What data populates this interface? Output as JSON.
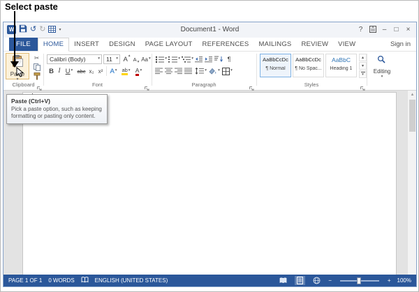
{
  "annotation": {
    "label": "Select paste"
  },
  "glyphs": {
    "dropdown": "▾",
    "up": "▴",
    "undo": "↺",
    "redo": "↻",
    "cut": "✂",
    "scroll_up": "▲"
  },
  "window": {
    "titlebar": {
      "app_initial": "W",
      "title": "Document1 - Word",
      "help": "?",
      "minimize": "–",
      "maximize": "□",
      "close": "×"
    },
    "tabs": [
      {
        "label": "FILE"
      },
      {
        "label": "HOME"
      },
      {
        "label": "INSERT"
      },
      {
        "label": "DESIGN"
      },
      {
        "label": "PAGE LAYOUT"
      },
      {
        "label": "REFERENCES"
      },
      {
        "label": "MAILINGS"
      },
      {
        "label": "REVIEW"
      },
      {
        "label": "VIEW"
      }
    ],
    "sign_in": "Sign in"
  },
  "ribbon": {
    "clipboard": {
      "paste": "Paste",
      "label": "Clipboard"
    },
    "font": {
      "name": "Calibri (Body)",
      "size": "11",
      "bold": "B",
      "italic": "I",
      "underline": "U",
      "strikethrough": "abc",
      "subscript": "x₂",
      "superscript": "x²",
      "grow": "A",
      "shrink": "A",
      "case": "Aa",
      "effects": "A",
      "highlight": "ab",
      "color": "A",
      "label": "Font"
    },
    "paragraph": {
      "pilcrow": "¶",
      "label": "Paragraph"
    },
    "styles": {
      "items": [
        {
          "preview": "AaBbCcDc",
          "name": "¶ Normal",
          "selected": true
        },
        {
          "preview": "AaBbCcDc",
          "name": "¶ No Spac..."
        },
        {
          "preview": "AaBbC",
          "name": "Heading 1"
        }
      ],
      "label": "Styles"
    },
    "editing": {
      "label": "Editing"
    }
  },
  "tooltip": {
    "title": "Paste (Ctrl+V)",
    "body": "Pick a paste option, such as keeping formatting or pasting only content."
  },
  "statusbar": {
    "page": "PAGE 1 OF 1",
    "words": "0 WORDS",
    "language": "ENGLISH (UNITED STATES)",
    "zoom_out": "−",
    "zoom_in": "+",
    "zoom_level": "100%"
  }
}
